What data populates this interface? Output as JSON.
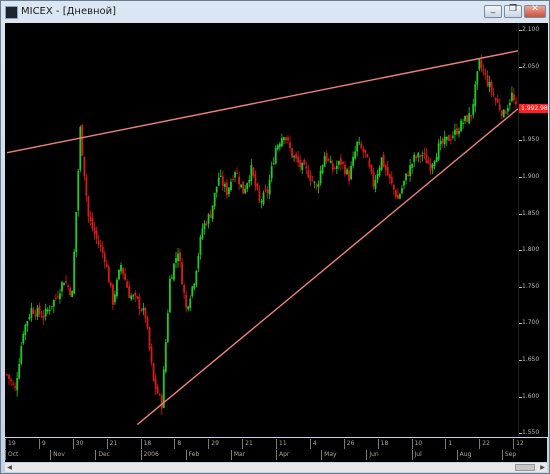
{
  "window": {
    "title": "MICEX - [Дневной]",
    "buttons": {
      "minimize": "_",
      "restore": "❐",
      "close": "✕"
    }
  },
  "chart": {
    "y_labels": [
      "2.100",
      "2.050",
      "1.992.98",
      "1.950",
      "1.900",
      "1.850",
      "1.800",
      "1.750",
      "1.700",
      "1.650",
      "1.600",
      "1.550"
    ],
    "y_label_values": [
      2100,
      2050,
      1992.98,
      1950,
      1900,
      1850,
      1800,
      1750,
      1700,
      1650,
      1600,
      1550
    ],
    "current_price": "1.992.98",
    "x_days": [
      "19",
      "9",
      "30",
      "21",
      "18",
      "8",
      "29",
      "21",
      "11",
      "4",
      "26",
      "18",
      "10",
      "1",
      "22",
      "12"
    ],
    "x_months": [
      "Oct",
      "Nov",
      "Dec",
      "2006",
      "Feb",
      "Mar",
      "Apr",
      "May",
      "Jun",
      "Jul",
      "Aug",
      "Sep"
    ],
    "colors": {
      "up": "#22cc22",
      "down": "#dd1a1a",
      "trendline": "#f08080",
      "background": "#000000"
    }
  },
  "chart_data": {
    "type": "candlestick",
    "y_range": [
      1545,
      2110
    ],
    "trendlines": [
      {
        "name": "upper",
        "from": [
          0,
          1933
        ],
        "to": [
          250,
          2072
        ]
      },
      {
        "name": "lower",
        "from": [
          64,
          1562
        ],
        "to": [
          250,
          1993
        ]
      }
    ],
    "close_path": [
      [
        0,
        1630
      ],
      [
        4,
        1610
      ],
      [
        8,
        1690
      ],
      [
        12,
        1720
      ],
      [
        18,
        1710
      ],
      [
        24,
        1735
      ],
      [
        28,
        1760
      ],
      [
        32,
        1740
      ],
      [
        36,
        1965
      ],
      [
        40,
        1845
      ],
      [
        44,
        1815
      ],
      [
        48,
        1790
      ],
      [
        52,
        1730
      ],
      [
        56,
        1780
      ],
      [
        60,
        1740
      ],
      [
        64,
        1730
      ],
      [
        68,
        1710
      ],
      [
        72,
        1620
      ],
      [
        76,
        1590
      ],
      [
        80,
        1760
      ],
      [
        84,
        1800
      ],
      [
        88,
        1720
      ],
      [
        92,
        1760
      ],
      [
        96,
        1830
      ],
      [
        100,
        1850
      ],
      [
        104,
        1900
      ],
      [
        108,
        1880
      ],
      [
        112,
        1910
      ],
      [
        116,
        1880
      ],
      [
        120,
        1910
      ],
      [
        124,
        1865
      ],
      [
        128,
        1880
      ],
      [
        132,
        1940
      ],
      [
        136,
        1960
      ],
      [
        140,
        1930
      ],
      [
        144,
        1915
      ],
      [
        148,
        1905
      ],
      [
        152,
        1885
      ],
      [
        156,
        1930
      ],
      [
        160,
        1910
      ],
      [
        164,
        1920
      ],
      [
        168,
        1900
      ],
      [
        172,
        1945
      ],
      [
        176,
        1930
      ],
      [
        180,
        1890
      ],
      [
        184,
        1925
      ],
      [
        188,
        1895
      ],
      [
        192,
        1870
      ],
      [
        196,
        1900
      ],
      [
        200,
        1925
      ],
      [
        204,
        1930
      ],
      [
        208,
        1915
      ],
      [
        212,
        1940
      ],
      [
        216,
        1950
      ],
      [
        220,
        1960
      ],
      [
        224,
        1975
      ],
      [
        228,
        1985
      ],
      [
        232,
        2055
      ],
      [
        236,
        2030
      ],
      [
        240,
        2005
      ],
      [
        244,
        1985
      ],
      [
        248,
        2012
      ],
      [
        250,
        1993
      ]
    ]
  }
}
